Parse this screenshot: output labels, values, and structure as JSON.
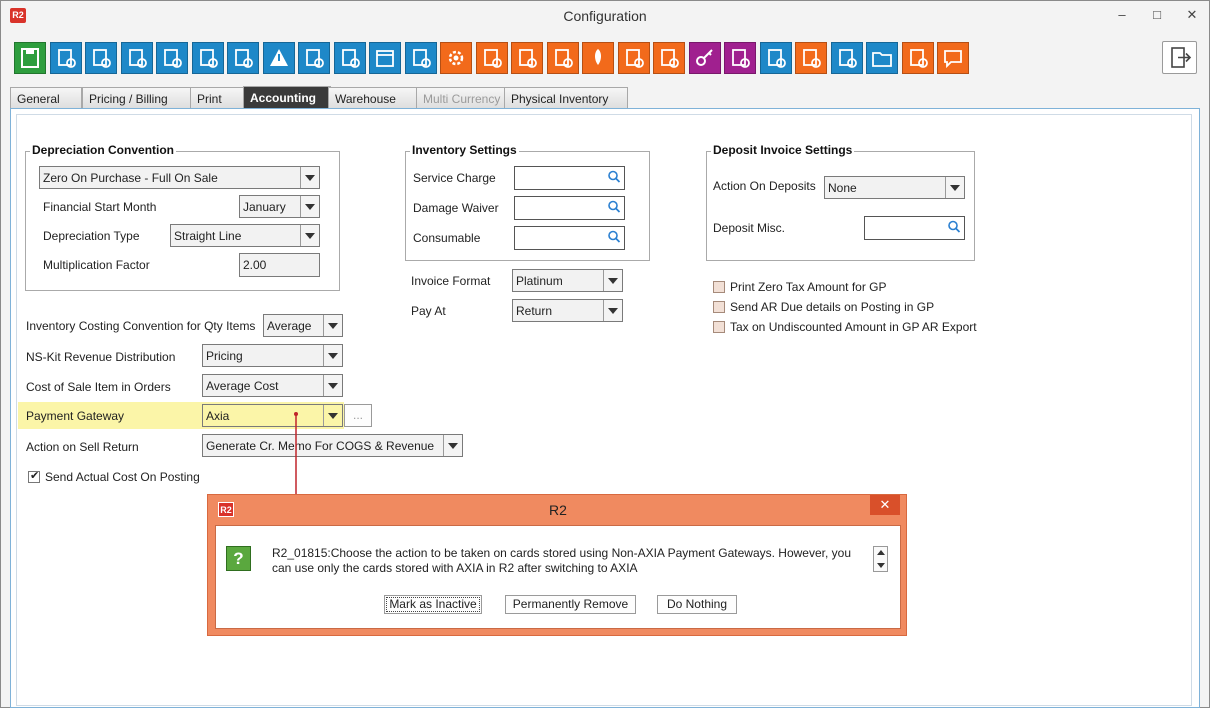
{
  "window": {
    "app_badge": "R2",
    "title": "Configuration",
    "minimize": "–",
    "maximize": "□",
    "close": "✕"
  },
  "toolbar": {
    "buttons": [
      {
        "name": "save",
        "color": "#2e9e3e"
      },
      {
        "name": "truck-settings",
        "color": "#1e88c8"
      },
      {
        "name": "db-settings",
        "color": "#1e88c8"
      },
      {
        "name": "calc-settings",
        "color": "#1e88c8"
      },
      {
        "name": "doc-settings",
        "color": "#1e88c8"
      },
      {
        "name": "flow-settings",
        "color": "#1e88c8"
      },
      {
        "name": "db-settings-2",
        "color": "#1e88c8"
      },
      {
        "name": "alert",
        "color": "#1e88c8"
      },
      {
        "name": "cursor-settings",
        "color": "#1e88c8"
      },
      {
        "name": "user",
        "color": "#1e88c8"
      },
      {
        "name": "calendar",
        "color": "#1e88c8"
      },
      {
        "name": "screen-settings",
        "color": "#1e88c8"
      },
      {
        "name": "gear",
        "color": "#f26a1b"
      },
      {
        "name": "dessert",
        "color": "#f26a1b"
      },
      {
        "name": "tag",
        "color": "#f26a1b"
      },
      {
        "name": "receipt",
        "color": "#f26a1b"
      },
      {
        "name": "rocket",
        "color": "#f26a1b"
      },
      {
        "name": "po",
        "color": "#f26a1b"
      },
      {
        "name": "po-2",
        "color": "#f26a1b"
      },
      {
        "name": "key",
        "color": "#a0208f"
      },
      {
        "name": "id-card",
        "color": "#a0208f"
      },
      {
        "name": "scanner",
        "color": "#1e88c8"
      },
      {
        "name": "lock-doc",
        "color": "#f26a1b"
      },
      {
        "name": "ticket",
        "color": "#1e88c8"
      },
      {
        "name": "folder",
        "color": "#1e88c8"
      },
      {
        "name": "doc-gear",
        "color": "#f26a1b"
      },
      {
        "name": "chat",
        "color": "#f26a1b"
      }
    ]
  },
  "tabs": [
    {
      "label": "General",
      "state": "normal"
    },
    {
      "label": "Pricing / Billing",
      "state": "normal"
    },
    {
      "label": "Print",
      "state": "normal"
    },
    {
      "label": "Accounting",
      "state": "active"
    },
    {
      "label": "Warehouse",
      "state": "normal"
    },
    {
      "label": "Multi Currency",
      "state": "disabled"
    },
    {
      "label": "Physical Inventory",
      "state": "normal"
    }
  ],
  "depreciation": {
    "title": "Depreciation Convention",
    "convention": "Zero On Purchase - Full On Sale",
    "fin_start_label": "Financial Start Month",
    "fin_start_value": "January",
    "dep_type_label": "Depreciation Type",
    "dep_type_value": "Straight Line",
    "mult_label": "Multiplication Factor",
    "mult_value": "2.00"
  },
  "inventory": {
    "title": "Inventory Settings",
    "service_charge_label": "Service Charge",
    "service_charge_value": "",
    "damage_waiver_label": "Damage Waiver",
    "damage_waiver_value": "",
    "consumable_label": "Consumable",
    "consumable_value": ""
  },
  "invoice": {
    "format_label": "Invoice Format",
    "format_value": "Platinum",
    "pay_at_label": "Pay At",
    "pay_at_value": "Return"
  },
  "deposit": {
    "title": "Deposit Invoice Settings",
    "action_label": "Action On Deposits",
    "action_value": "None",
    "misc_label": "Deposit Misc.",
    "misc_value": ""
  },
  "gp_options": [
    {
      "label": "Print Zero Tax Amount for GP",
      "checked": false
    },
    {
      "label": "Send AR Due details on Posting in GP",
      "checked": false
    },
    {
      "label": "Tax on Undiscounted Amount in GP AR Export",
      "checked": false
    }
  ],
  "costing": {
    "inv_costing_label": "Inventory Costing Convention for Qty Items",
    "inv_costing_value": "Average",
    "nskit_label": "NS-Kit Revenue Distribution",
    "nskit_value": "Pricing",
    "cost_sale_label": "Cost of Sale Item in Orders",
    "cost_sale_value": "Average Cost",
    "gateway_label": "Payment Gateway",
    "gateway_value": "Axia",
    "gateway_more": "...",
    "sell_return_label": "Action on Sell Return",
    "sell_return_value": "Generate Cr. Memo For COGS & Revenue",
    "send_cost_label": "Send Actual Cost On Posting",
    "send_cost_checked": true
  },
  "dialog": {
    "badge": "R2",
    "title": "R2",
    "close": "✕",
    "icon_char": "?",
    "message_line1": "R2_01815:Choose the action to be taken on cards stored using Non-AXIA Payment Gateways. However, you",
    "message_line2": "can use only the cards stored with AXIA in R2 after switching to AXIA",
    "btn_inactive": "Mark as Inactive",
    "btn_remove": "Permanently Remove",
    "btn_nothing": "Do Nothing"
  },
  "colors": {
    "highlight": "#fbf5a8",
    "arrow": "#c0242a",
    "dialog": "#f08a60",
    "active_tab": "#3a3a3a"
  }
}
